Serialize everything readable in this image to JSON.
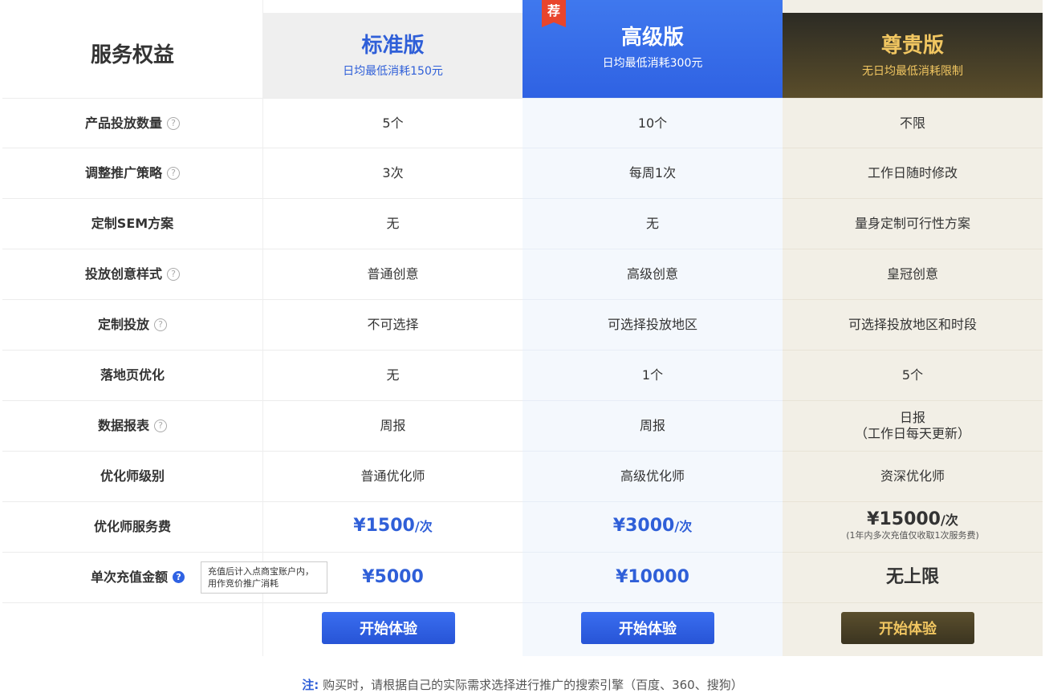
{
  "features_title": "服务权益",
  "plans": [
    {
      "name": "标准版",
      "sub": "日均最低消耗150元",
      "button": "开始体验"
    },
    {
      "name": "高级版",
      "sub": "日均最低消耗300元",
      "button": "开始体验",
      "badge": "荐"
    },
    {
      "name": "尊贵版",
      "sub": "无日均最低消耗限制",
      "button": "开始体验"
    }
  ],
  "rows": [
    {
      "label": "产品投放数量",
      "help": "?",
      "values": [
        "5个",
        "10个",
        "不限"
      ]
    },
    {
      "label": "调整推广策略",
      "help": "?",
      "values": [
        "3次",
        "每周1次",
        "工作日随时修改"
      ]
    },
    {
      "label": "定制SEM方案",
      "values": [
        "无",
        "无",
        "量身定制可行性方案"
      ]
    },
    {
      "label": "投放创意样式",
      "help": "?",
      "values": [
        "普通创意",
        "高级创意",
        "皇冠创意"
      ]
    },
    {
      "label": "定制投放",
      "help": "?",
      "values": [
        "不可选择",
        "可选择投放地区",
        "可选择投放地区和时段"
      ]
    },
    {
      "label": "落地页优化",
      "values": [
        "无",
        "1个",
        "5个"
      ]
    },
    {
      "label": "数据报表",
      "help": "?",
      "values": [
        "周报",
        "周报",
        "日报"
      ],
      "extra": "（工作日每天更新）"
    },
    {
      "label": "优化师级别",
      "values": [
        "普通优化师",
        "高级优化师",
        "资深优化师"
      ]
    },
    {
      "label": "优化师服务费",
      "values": [
        "¥1500",
        "¥3000",
        "¥15000"
      ],
      "unit": "/次",
      "extra": "(1年内多次充值仅收取1次服务费)"
    },
    {
      "label": "单次充值金额",
      "help": "?",
      "values": [
        "¥5000",
        "¥10000",
        "无上限"
      ]
    }
  ],
  "tooltip": "充值后计入点商宝账户内，用作竞价推广消耗",
  "note_label": "注:",
  "note_text": "购买时，请根据自己的实际需求选择进行推广的搜索引擎（百度、360、搜狗）",
  "colors": {
    "blue": "#2f62e3",
    "gold": "#f1c661",
    "dark": "#3b3420",
    "red": "#e8452c"
  }
}
